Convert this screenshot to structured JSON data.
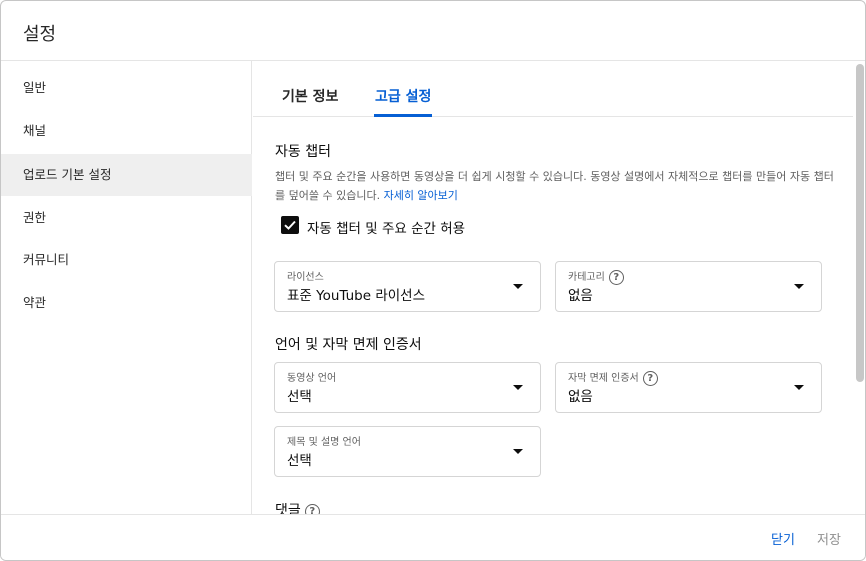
{
  "dialog": {
    "title": "설정"
  },
  "sidebar": {
    "items": [
      {
        "label": "일반"
      },
      {
        "label": "채널"
      },
      {
        "label": "업로드 기본 설정"
      },
      {
        "label": "권한"
      },
      {
        "label": "커뮤니티"
      },
      {
        "label": "약관"
      }
    ],
    "active_index": 2
  },
  "tabs": [
    {
      "label": "기본 정보"
    },
    {
      "label": "고급 설정"
    }
  ],
  "active_tab": 1,
  "auto_chapters": {
    "title": "자동 챕터",
    "description": "챕터 및 주요 순간을 사용하면 동영상을 더 쉽게 시청할 수 있습니다. 동영상 설명에서 자체적으로 챕터를 만들어 자동 챕터를 덮어쓸 수 있습니다.",
    "learn_more": "자세히 알아보기",
    "checkbox_label": "자동 챕터 및 주요 순간 허용",
    "checked": true
  },
  "license": {
    "label": "라이선스",
    "value": "표준 YouTube 라이선스"
  },
  "category": {
    "label": "카테고리",
    "value": "없음"
  },
  "language_section": {
    "title": "언어 및 자막 면제 인증서"
  },
  "video_language": {
    "label": "동영상 언어",
    "value": "선택"
  },
  "caption_cert": {
    "label": "자막 면제 인증서",
    "value": "없음"
  },
  "title_desc_language": {
    "label": "제목 및 설명 언어",
    "value": "선택"
  },
  "comments": {
    "title": "댓글"
  },
  "footer": {
    "close_label": "닫기",
    "save_label": "저장"
  },
  "help_glyph": "?",
  "colors": {
    "accent": "#065fd4",
    "active_bg": "#efefef",
    "border": "#e5e5e5"
  }
}
